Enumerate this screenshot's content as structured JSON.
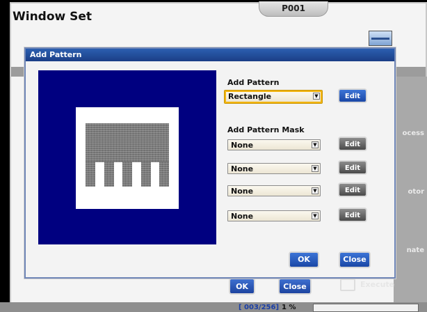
{
  "background_window": {
    "title": "Window Set",
    "code": "P001",
    "right_labels": [
      "ocess",
      "otor",
      "nate"
    ],
    "ok_label": "OK",
    "close_label": "Close",
    "execute_label": "Execute"
  },
  "status_bar": {
    "counter": "[ 003/256]",
    "percent": "1 %"
  },
  "dialog": {
    "title": "Add Pattern",
    "add_pattern_label": "Add Pattern",
    "add_pattern_value": "Rectangle",
    "add_pattern_mask_label": "Add Pattern Mask",
    "masks": [
      {
        "value": "None",
        "edit_label": "Edit"
      },
      {
        "value": "None",
        "edit_label": "Edit"
      },
      {
        "value": "None",
        "edit_label": "Edit"
      },
      {
        "value": "None",
        "edit_label": "Edit"
      }
    ],
    "edit_label": "Edit",
    "ok_label": "OK",
    "close_label": "Close"
  },
  "colors": {
    "preview_background": "#000080",
    "dialog_titlebar": "#1b3e86",
    "selected_combo_border": "#f2b40e"
  },
  "icons": {
    "combo_arrow": "chevron-down-icon",
    "window_icon": "window-icon",
    "execute_icon": "execute-icon"
  }
}
